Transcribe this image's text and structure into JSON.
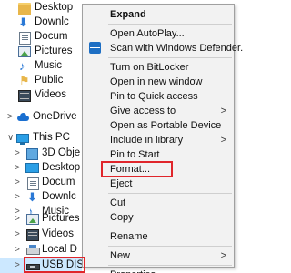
{
  "nav": {
    "items": [
      {
        "label": "Desktop",
        "icon": "desktop-icon",
        "chevron": ""
      },
      {
        "label": "Downlc",
        "icon": "download-icon",
        "chevron": ""
      },
      {
        "label": "Docum",
        "icon": "document-icon",
        "chevron": ""
      },
      {
        "label": "Pictures",
        "icon": "pictures-icon",
        "chevron": ""
      },
      {
        "label": "Music",
        "icon": "music-icon",
        "chevron": ""
      },
      {
        "label": "Public",
        "icon": "public-icon",
        "chevron": ""
      },
      {
        "label": "Videos",
        "icon": "videos-icon",
        "chevron": ""
      },
      {
        "label": "OneDrive",
        "icon": "onedrive-icon",
        "chevron": ">"
      },
      {
        "label": "This PC",
        "icon": "pc-icon",
        "chevron": "∨"
      },
      {
        "label": "3D Obje",
        "icon": "3d-objects-icon",
        "chevron": ">"
      },
      {
        "label": "Desktop",
        "icon": "desktop-icon",
        "chevron": ">"
      },
      {
        "label": "Docum",
        "icon": "document-icon",
        "chevron": ">"
      },
      {
        "label": "Downlc",
        "icon": "download-icon",
        "chevron": ">"
      },
      {
        "label": "Music",
        "icon": "music-icon",
        "chevron": ">"
      },
      {
        "label": "Pictures",
        "icon": "pictures-icon",
        "chevron": ">"
      },
      {
        "label": "Videos",
        "icon": "videos-icon",
        "chevron": ">"
      },
      {
        "label": "Local D",
        "icon": "local-disk-icon",
        "chevron": ">"
      },
      {
        "label": "USB DIS",
        "icon": "usb-drive-icon",
        "chevron": ">"
      }
    ]
  },
  "context_menu": {
    "items": [
      {
        "label": "Expand",
        "bold": true
      },
      {
        "label": "Open AutoPlay..."
      },
      {
        "label": "Scan with Windows Defender...",
        "icon": "windows-defender-icon"
      },
      {
        "label": "Turn on BitLocker"
      },
      {
        "label": "Open in new window"
      },
      {
        "label": "Pin to Quick access"
      },
      {
        "label": "Give access to",
        "submenu": true
      },
      {
        "label": "Open as Portable Device"
      },
      {
        "label": "Include in library",
        "submenu": true
      },
      {
        "label": "Pin to Start"
      },
      {
        "label": "Format..."
      },
      {
        "label": "Eject"
      },
      {
        "label": "Cut"
      },
      {
        "label": "Copy"
      },
      {
        "label": "Rename"
      },
      {
        "label": "New",
        "submenu": true
      },
      {
        "label": "Properties"
      }
    ],
    "submenu_arrow": ">"
  },
  "colors": {
    "highlight": "#e0262b",
    "menu_bg": "#f2f2f2",
    "selected_row": "#cce8ff"
  }
}
